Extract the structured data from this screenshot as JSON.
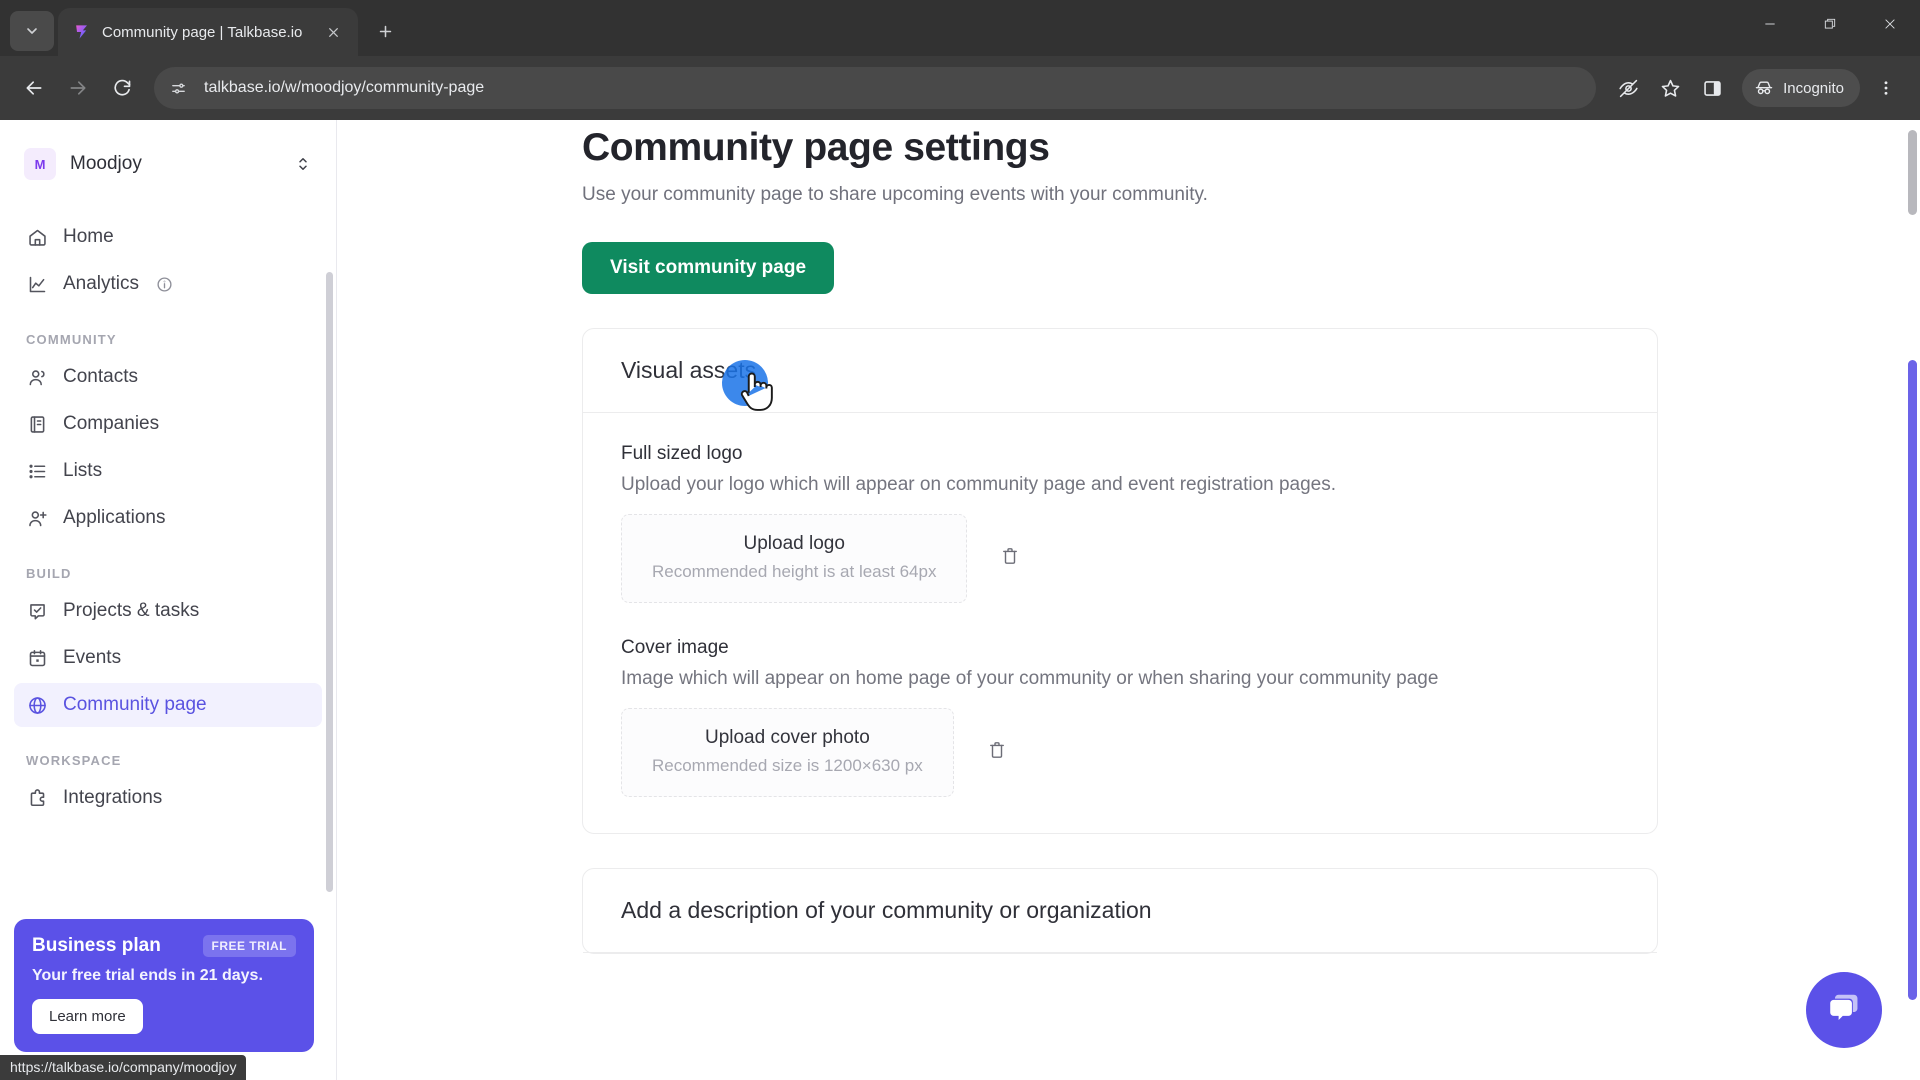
{
  "browser": {
    "tab": {
      "title": "Community page | Talkbase.io",
      "favicon_icon": "talkbase-logo-icon",
      "close_icon": "close-icon"
    },
    "tab_search_icon": "tab-search-chevron-icon",
    "new_tab_icon": "plus-icon",
    "window_controls": {
      "minimize_icon": "minimize-icon",
      "maximize_icon": "restore-icon",
      "close_icon": "window-close-icon"
    },
    "nav": {
      "back_icon": "arrow-left-icon",
      "forward_icon": "arrow-right-icon",
      "reload_icon": "reload-icon"
    },
    "omnibox": {
      "site_settings_icon": "tune-icon",
      "url": "talkbase.io/w/moodjoy/community-page"
    },
    "toolbar_right": {
      "tracking_icon": "eye-off-icon",
      "bookmark_icon": "star-icon",
      "side_panel_icon": "side-panel-icon",
      "incognito_label": "Incognito",
      "incognito_icon": "incognito-hat-icon",
      "menu_icon": "three-dots-vertical-icon"
    }
  },
  "status_bar": {
    "link_url": "https://talkbase.io/company/moodjoy"
  },
  "sidebar": {
    "workspace": {
      "initial": "M",
      "name": "Moodjoy",
      "switch_icon": "chevron-up-down-icon"
    },
    "top_items": [
      {
        "label": "Home",
        "icon": "home-icon"
      },
      {
        "label": "Analytics",
        "icon": "chart-line-icon",
        "info_icon": "info-circle-icon"
      }
    ],
    "sections": [
      {
        "title": "COMMUNITY",
        "items": [
          {
            "label": "Contacts",
            "icon": "people-icon"
          },
          {
            "label": "Companies",
            "icon": "building-icon"
          },
          {
            "label": "Lists",
            "icon": "list-icon"
          },
          {
            "label": "Applications",
            "icon": "person-add-icon"
          }
        ]
      },
      {
        "title": "BUILD",
        "items": [
          {
            "label": "Projects & tasks",
            "icon": "check-square-icon"
          },
          {
            "label": "Events",
            "icon": "calendar-icon"
          },
          {
            "label": "Community page",
            "icon": "globe-icon",
            "active": true
          }
        ]
      },
      {
        "title": "WORKSPACE",
        "items": [
          {
            "label": "Integrations",
            "icon": "puzzle-icon"
          }
        ]
      }
    ],
    "plan_card": {
      "title": "Business plan",
      "badge": "FREE TRIAL",
      "subtitle": "Your free trial ends in 21 days.",
      "button": "Learn more"
    }
  },
  "main": {
    "title": "Community page settings",
    "subtitle": "Use your community page to share upcoming events with your community.",
    "primary_button": "Visit community page",
    "visual_assets": {
      "heading": "Visual assets",
      "fields": [
        {
          "label": "Full sized logo",
          "description": "Upload your logo which will appear on community page and event registration pages.",
          "upload_title": "Upload logo",
          "upload_hint": "Recommended height is at least 64px",
          "delete_icon": "trash-icon"
        },
        {
          "label": "Cover image",
          "description": "Image which will appear on home page of your community or when sharing your community page",
          "upload_title": "Upload cover photo",
          "upload_hint": "Recommended size is 1200×630 px",
          "delete_icon": "trash-icon"
        }
      ]
    },
    "description_card": {
      "heading": "Add a description of your community or organization"
    },
    "chat_widget": {
      "icon": "chat-bubbles-icon"
    }
  },
  "colors": {
    "accent_purple": "#5b51e8",
    "primary_green": "#0f8a5f",
    "chrome_dark": "#3b3b3b"
  }
}
